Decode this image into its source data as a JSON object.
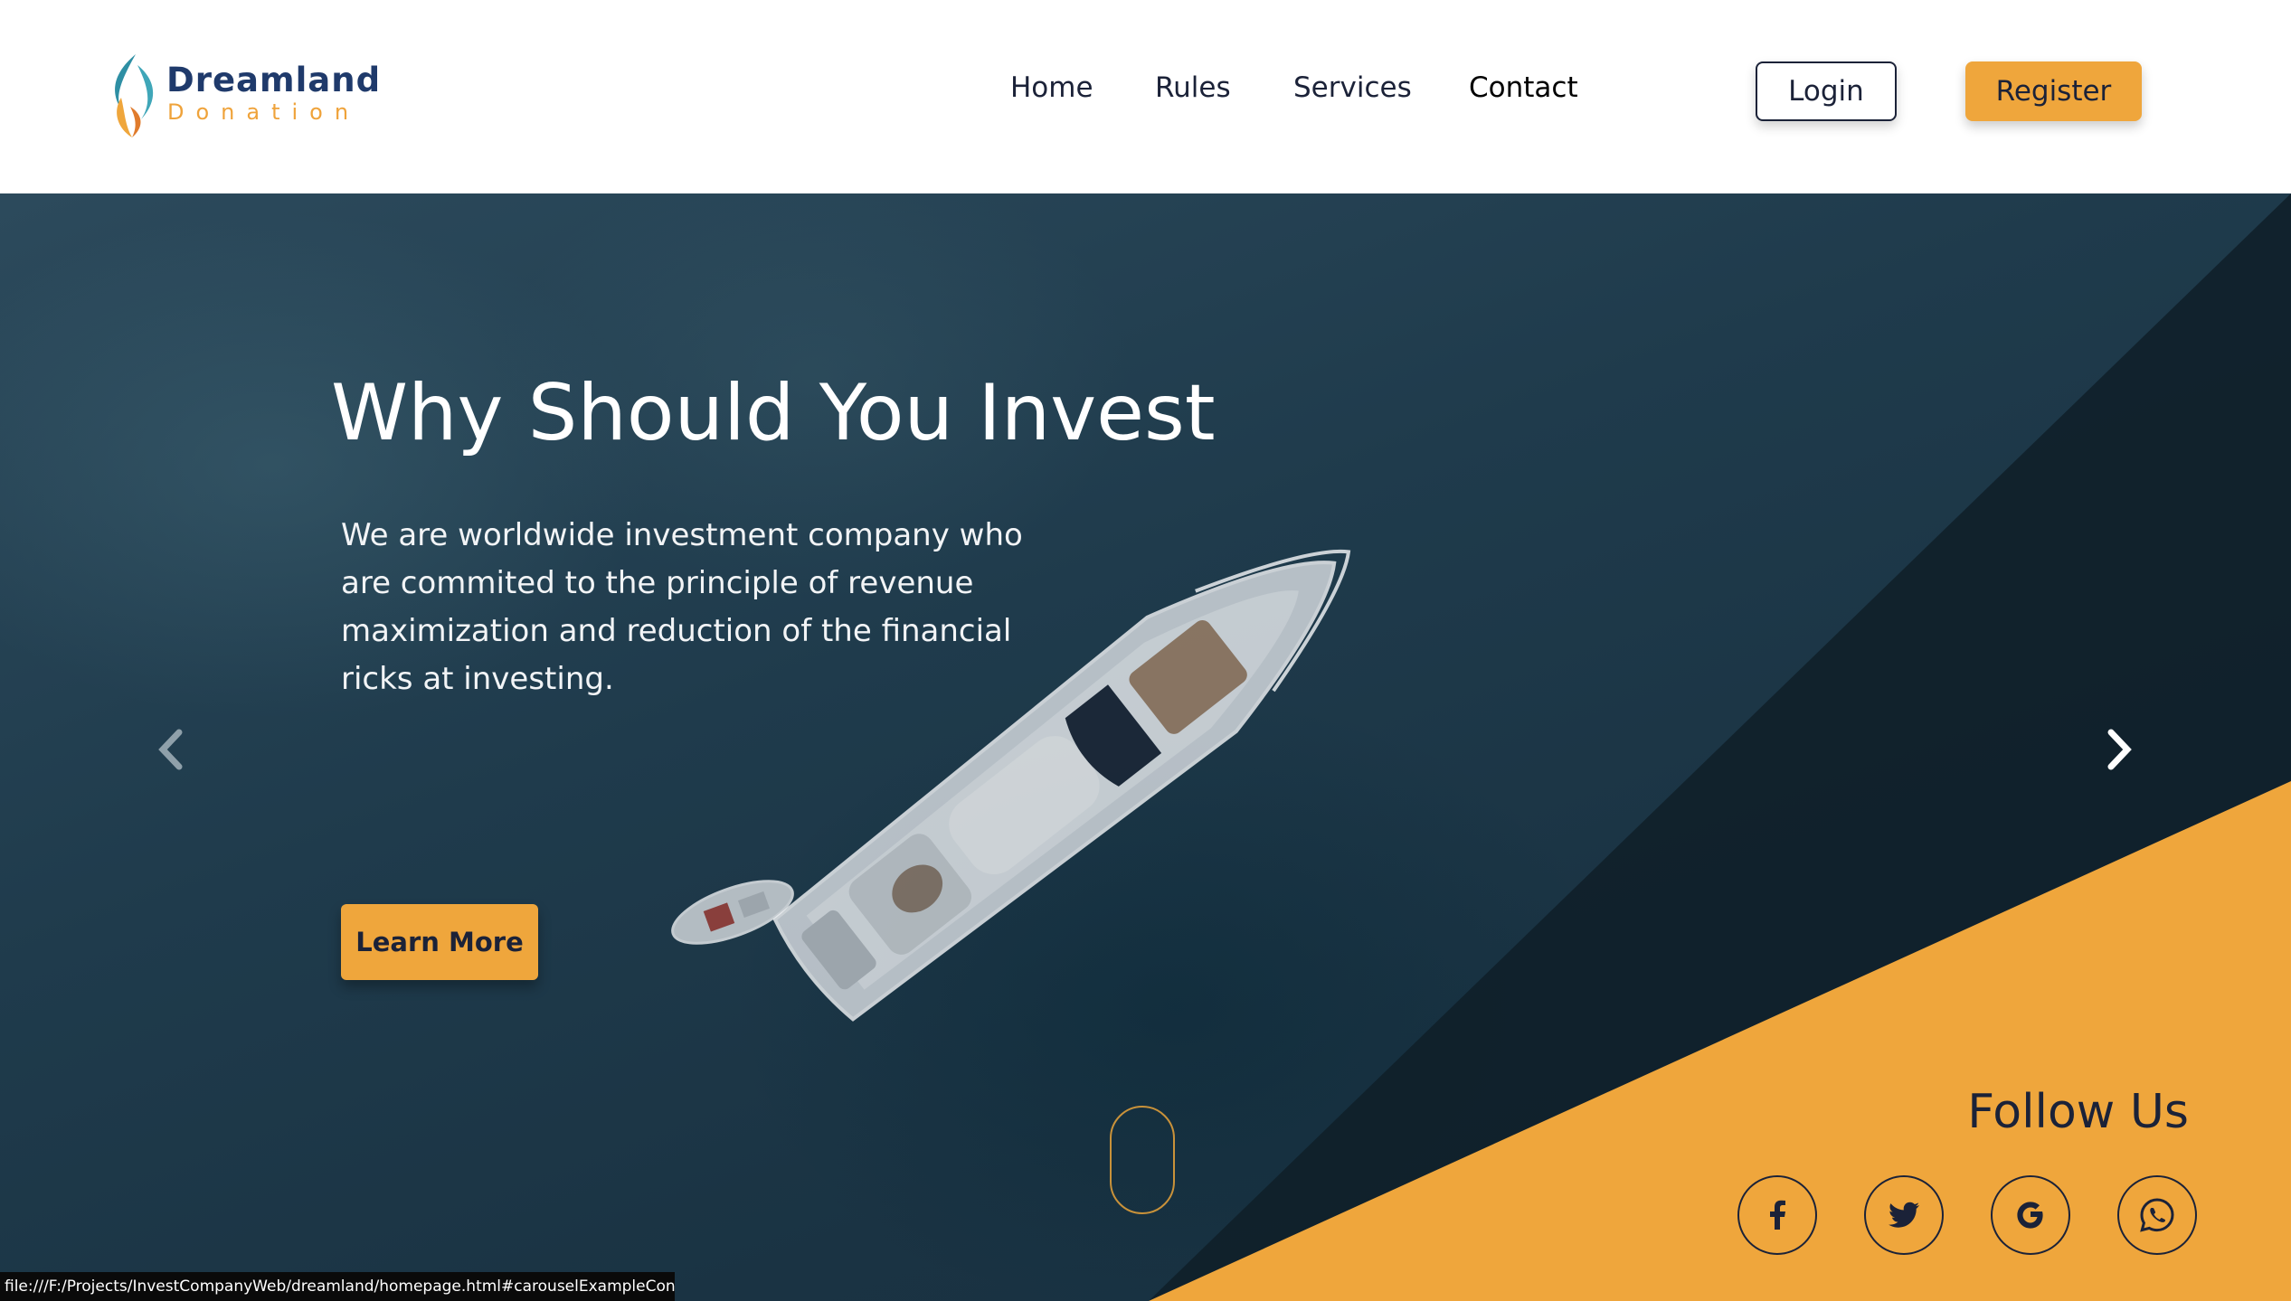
{
  "brand": {
    "name_line1": "Dreamland",
    "name_line2": "Donation"
  },
  "nav": {
    "items": [
      {
        "label": "Home"
      },
      {
        "label": "Rules"
      },
      {
        "label": "Services"
      },
      {
        "label": "Contact"
      }
    ],
    "login_label": "Login",
    "register_label": "Register"
  },
  "hero": {
    "title": "Why Should You Invest",
    "description": "We are worldwide investment company who are commited to the principle of revenue maximization and reduction of the financial ricks at investing.",
    "cta_label": "Learn More"
  },
  "carousel": {
    "prev_icon": "chevron-left-icon",
    "next_icon": "chevron-right-icon"
  },
  "follow": {
    "title": "Follow Us",
    "icons": [
      "facebook-icon",
      "twitter-icon",
      "google-icon",
      "whatsapp-icon"
    ]
  },
  "status_bar": {
    "url": "file:///F:/Projects/InvestCompanyWeb/dreamland/homepage.html#carouselExampleControls"
  },
  "colors": {
    "accent": "#efa63c",
    "navy": "#1b2238",
    "logo_blue": "#1f3a6b",
    "logo_teal": "#2e8fa4"
  }
}
